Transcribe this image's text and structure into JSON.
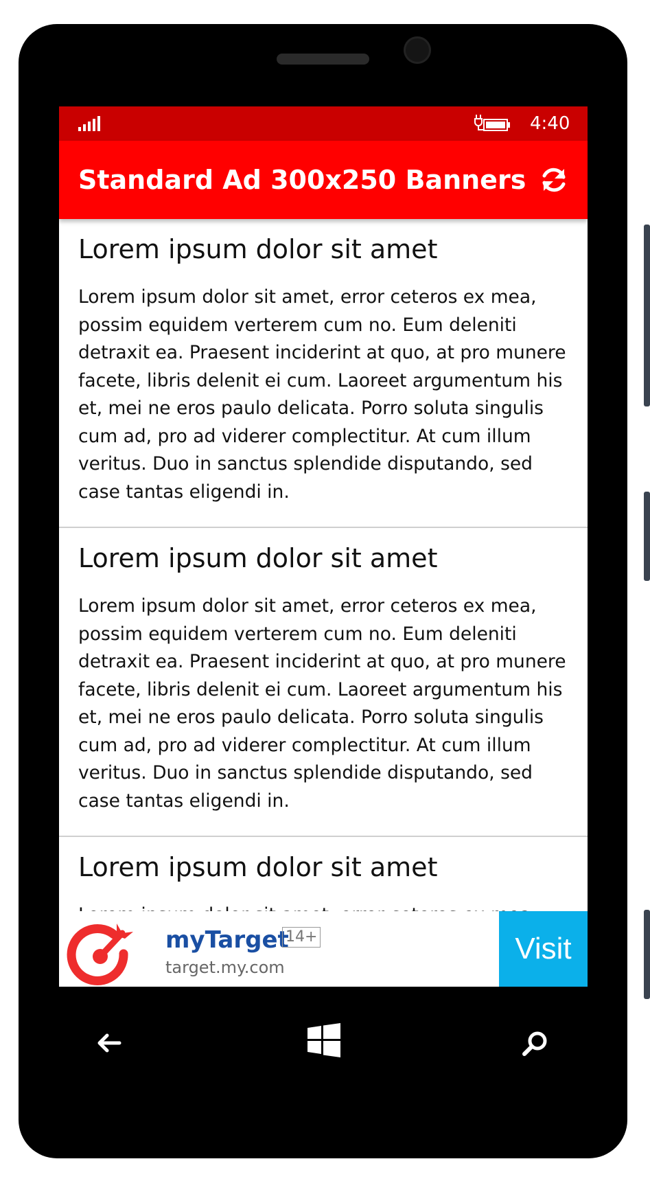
{
  "status_bar": {
    "time": "4:40",
    "signal_icon": "signal-bars-icon",
    "battery_icon": "battery-charging-icon"
  },
  "app_bar": {
    "title": "Standard Ad 300x250 Banners",
    "refresh_icon": "refresh-icon",
    "background_color": "#ff0000",
    "status_color": "#c90000"
  },
  "articles": [
    {
      "title": "Lorem ipsum dolor sit amet",
      "body": "Lorem ipsum dolor sit amet, error ceteros ex mea, possim equidem verterem cum no. Eum deleniti detraxit ea. Praesent inciderint at quo, at pro munere facete, libris delenit ei cum. Laoreet argumentum his et, mei ne eros paulo delicata. Porro soluta singulis cum ad, pro ad viderer complectitur. At cum illum veritus. Duo in sanctus splendide disputando, sed case tantas eligendi in."
    },
    {
      "title": "Lorem ipsum dolor sit amet",
      "body": "Lorem ipsum dolor sit amet, error ceteros ex mea, possim equidem verterem cum no. Eum deleniti detraxit ea. Praesent inciderint at quo, at pro munere facete, libris delenit ei cum. Laoreet argumentum his et, mei ne eros paulo delicata. Porro soluta singulis cum ad, pro ad viderer complectitur. At cum illum veritus. Duo in sanctus splendide disputando, sed case tantas eligendi in."
    },
    {
      "title": "Lorem ipsum dolor sit amet",
      "body": "Lorem ipsum dolor sit amet, error ceteros ex mea, possim equidem verterem cum no."
    }
  ],
  "ad_banner": {
    "brand": "myTarget",
    "age_rating": "14+",
    "url": "target.my.com",
    "cta_label": "Visit",
    "logo_icon": "mytarget-logo-icon",
    "cta_color": "#0bb0ea",
    "brand_color": "#1a4fa3"
  },
  "nav_bar": {
    "back_icon": "back-arrow-icon",
    "start_icon": "windows-logo-icon",
    "search_icon": "search-icon"
  }
}
